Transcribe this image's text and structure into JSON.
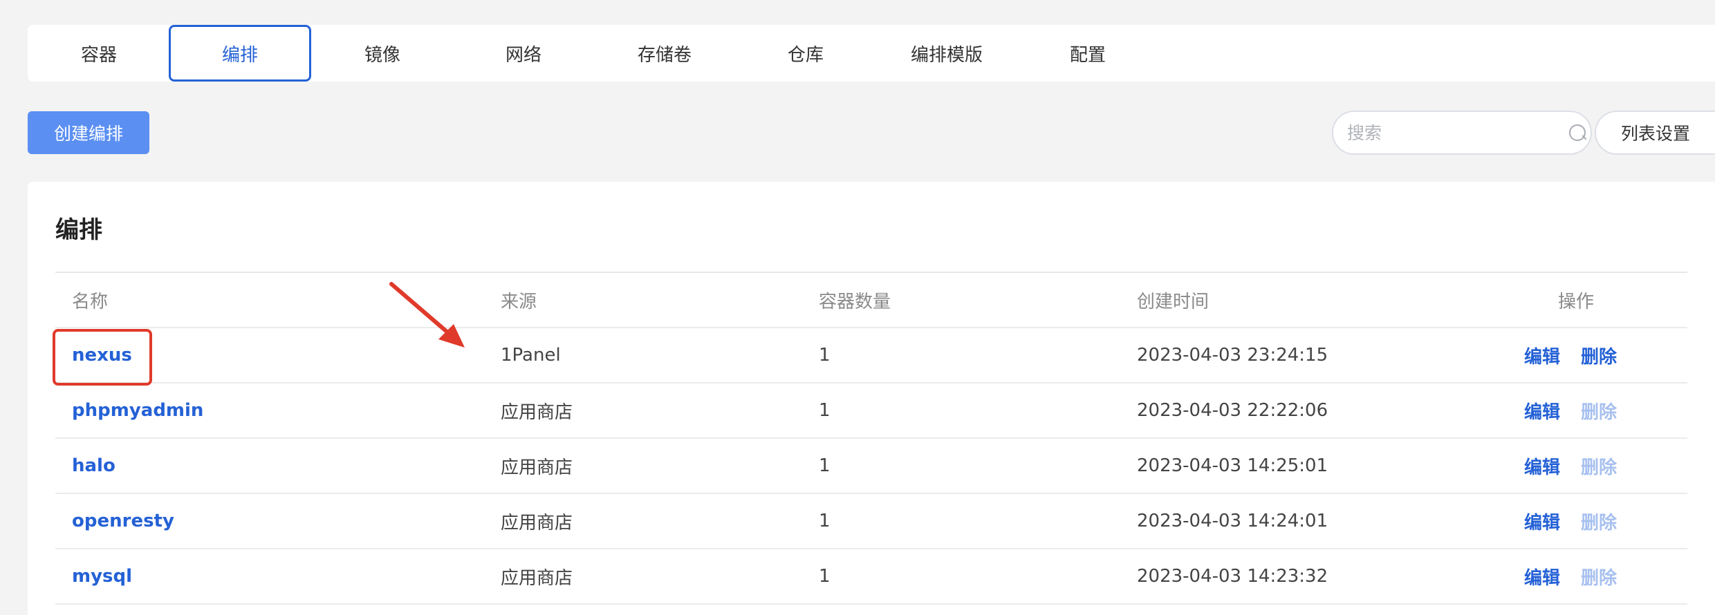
{
  "tabs": [
    {
      "label": "容器"
    },
    {
      "label": "编排"
    },
    {
      "label": "镜像"
    },
    {
      "label": "网络"
    },
    {
      "label": "存储卷"
    },
    {
      "label": "仓库"
    },
    {
      "label": "编排模版"
    },
    {
      "label": "配置"
    }
  ],
  "active_tab": "编排",
  "toolbar": {
    "create_label": "创建编排",
    "search_placeholder": "搜索",
    "settings_label": "列表设置"
  },
  "card": {
    "title": "编排",
    "columns": {
      "name": "名称",
      "source": "来源",
      "count": "容器数量",
      "created": "创建时间",
      "actions": "操作"
    },
    "rows": [
      {
        "name": "nexus",
        "source": "1Panel",
        "count": "1",
        "created": "2023-04-03 23:24:15",
        "edit": "编辑",
        "delete": "删除"
      },
      {
        "name": "phpmyadmin",
        "source": "应用商店",
        "count": "1",
        "created": "2023-04-03 22:22:06",
        "edit": "编辑",
        "delete": "删除"
      },
      {
        "name": "halo",
        "source": "应用商店",
        "count": "1",
        "created": "2023-04-03 14:25:01",
        "edit": "编辑",
        "delete": "删除"
      },
      {
        "name": "openresty",
        "source": "应用商店",
        "count": "1",
        "created": "2023-04-03 14:24:01",
        "edit": "编辑",
        "delete": "删除"
      },
      {
        "name": "mysql",
        "source": "应用商店",
        "count": "1",
        "created": "2023-04-03 14:23:32",
        "edit": "编辑",
        "delete": "删除"
      }
    ]
  },
  "colors": {
    "accent": "#2461d6",
    "primary_button": "#5b8ff2",
    "delete_disabled": "#a7c0ef",
    "annotation": "#e03a2b"
  },
  "icons": {
    "search": "search-icon",
    "arrow": "arrow-annotation-icon"
  }
}
